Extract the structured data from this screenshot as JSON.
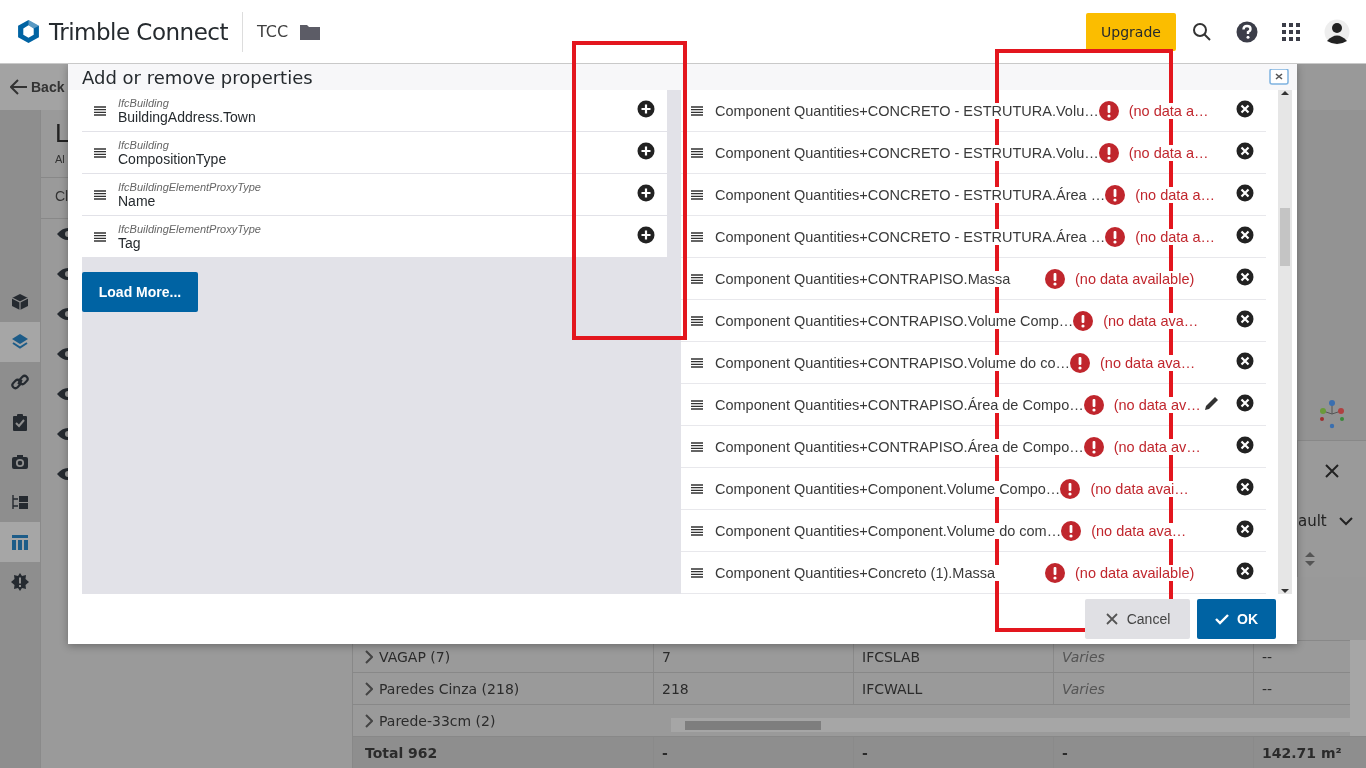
{
  "header": {
    "logo_text": "Trimble Connect",
    "project": "TCC",
    "upgrade": "Upgrade"
  },
  "back_button": "Back",
  "side_rail": [
    {
      "kind": "cube",
      "selected": false
    },
    {
      "kind": "layers",
      "selected": true
    },
    {
      "kind": "link",
      "selected": false
    },
    {
      "kind": "clipboard",
      "selected": false
    },
    {
      "kind": "camera",
      "selected": false
    },
    {
      "kind": "tree",
      "selected": false
    },
    {
      "kind": "table",
      "selected": true
    },
    {
      "kind": "badge",
      "selected": false
    }
  ],
  "panel": {
    "title": "L",
    "subtitle": "Al",
    "column_1": "Cl"
  },
  "view_selector": "ault",
  "table": {
    "rows": [
      [
        "VAGAP (7)",
        "7",
        "IFCSLAB",
        "Varies",
        "--"
      ],
      [
        "Paredes Cinza (218)",
        "218",
        "IFCWALL",
        "Varies",
        "--"
      ],
      [
        "Parede-33cm (2)"
      ]
    ],
    "total": [
      "Total 962",
      "-",
      "-",
      "-",
      "142.71 m²"
    ]
  },
  "dialog": {
    "title": "Add or remove properties",
    "available": [
      {
        "group": "IfcBuilding",
        "name": "BuildingAddress.Town"
      },
      {
        "group": "IfcBuilding",
        "name": "CompositionType"
      },
      {
        "group": "IfcBuildingElementProxyType",
        "name": "Name"
      },
      {
        "group": "IfcBuildingElementProxyType",
        "name": "Tag"
      }
    ],
    "load_more": "Load More...",
    "selected": [
      {
        "name": "Component Quantities+CONCRETO - ESTRUTURA.Volu…",
        "status": "(no data a…",
        "editable": false
      },
      {
        "name": "Component Quantities+CONCRETO - ESTRUTURA.Volu…",
        "status": "(no data a…",
        "editable": false
      },
      {
        "name": "Component Quantities+CONCRETO - ESTRUTURA.Área …",
        "status": "(no data a…",
        "editable": false
      },
      {
        "name": "Component Quantities+CONCRETO - ESTRUTURA.Área …",
        "status": "(no data a…",
        "editable": false
      },
      {
        "name": "Component Quantities+CONTRAPISO.Massa",
        "status": "(no data available)",
        "editable": false
      },
      {
        "name": "Component Quantities+CONTRAPISO.Volume Comp…",
        "status": "(no data ava…",
        "editable": false
      },
      {
        "name": "Component Quantities+CONTRAPISO.Volume do co…",
        "status": "(no data ava…",
        "editable": false
      },
      {
        "name": "Component Quantities+CONTRAPISO.Área de Compo…",
        "status": "(no data av…",
        "editable": true
      },
      {
        "name": "Component Quantities+CONTRAPISO.Área de Compo…",
        "status": "(no data av…",
        "editable": false
      },
      {
        "name": "Component Quantities+Component.Volume Compo…",
        "status": "(no data avai…",
        "editable": false
      },
      {
        "name": "Component Quantities+Component.Volume do com…",
        "status": "(no data ava…",
        "editable": false
      },
      {
        "name": "Component Quantities+Concreto (1).Massa",
        "status": "(no data available)",
        "editable": false
      }
    ],
    "buttons": [
      {
        "kind": "cancel",
        "label": "Cancel"
      },
      {
        "kind": "ok",
        "label": "OK"
      }
    ]
  }
}
